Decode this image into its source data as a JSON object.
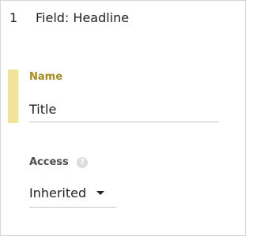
{
  "field": {
    "index": "1",
    "title": "Field: Headline"
  },
  "name_group": {
    "label": "Name",
    "value": "Title"
  },
  "access_group": {
    "label": "Access",
    "help_icon": "?",
    "selected": "Inherited"
  },
  "colors": {
    "accent_label": "#a58a1d",
    "active_bar": "#f1e39a"
  },
  "icons": {
    "help": "help-icon",
    "dropdown": "caret-down-icon"
  }
}
